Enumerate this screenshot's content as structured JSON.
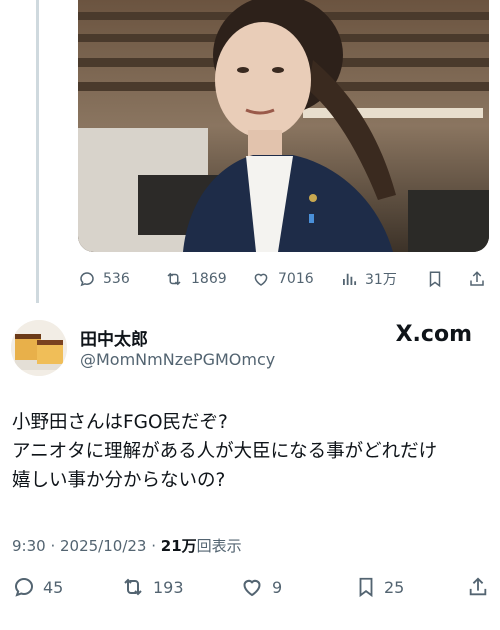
{
  "quoted_tweet": {
    "stats": {
      "replies": "536",
      "retweets": "1869",
      "likes": "7016",
      "views": "31万"
    }
  },
  "tweet": {
    "author": {
      "display_name": "田中太郎",
      "handle": "@MomNmNzePGMOmcy"
    },
    "brand": "X.com",
    "text_lines": [
      "小野田さんはFGO民だぞ?",
      "アニオタに理解がある人が大臣になる事がどれだけ",
      "嬉しい事か分からないの?"
    ],
    "time": "9:30",
    "separator": " · ",
    "date": "2025/10/23",
    "views_count": "21万",
    "views_label": "回表示",
    "stats": {
      "replies": "45",
      "retweets": "193",
      "likes": "9",
      "bookmarks": "25"
    }
  },
  "icons": [
    "reply-icon",
    "retweet-icon",
    "like-icon",
    "views-icon",
    "bookmark-icon",
    "share-icon"
  ],
  "colors": {
    "text": "#0f1419",
    "secondary": "#536471",
    "thread_line": "#cfd9de"
  }
}
